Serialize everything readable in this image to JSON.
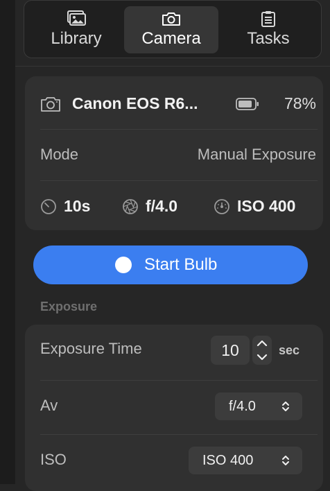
{
  "tabs": [
    {
      "label": "Library",
      "icon": "photo-library-icon"
    },
    {
      "label": "Camera",
      "icon": "camera-icon",
      "active": true
    },
    {
      "label": "Tasks",
      "icon": "clipboard-list-icon"
    }
  ],
  "camera": {
    "name": "Canon EOS R6...",
    "battery_percent": "78%"
  },
  "mode": {
    "label": "Mode",
    "value": "Manual Exposure"
  },
  "stats": {
    "shutter": "10s",
    "aperture": "f/4.0",
    "iso": "ISO 400"
  },
  "bulb_button": {
    "label": "Start Bulb"
  },
  "exposure_section": {
    "title": "Exposure",
    "time": {
      "label": "Exposure Time",
      "value": "10",
      "unit": "sec"
    },
    "av": {
      "label": "Av",
      "value": "f/4.0"
    },
    "iso": {
      "label": "ISO",
      "value": "ISO 400"
    }
  },
  "colors": {
    "accent": "#3b7ef0",
    "background": "#262626",
    "card": "#303030"
  }
}
